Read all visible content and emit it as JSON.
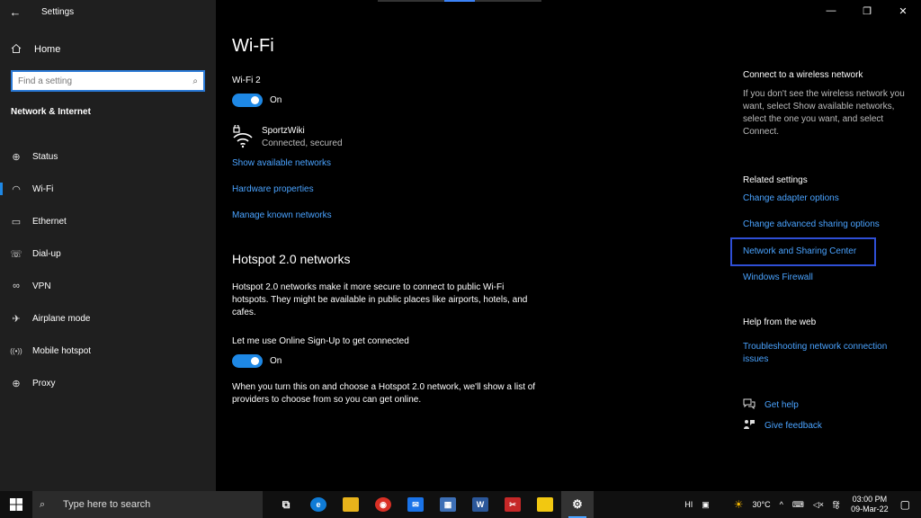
{
  "window": {
    "title": "Settings",
    "back_glyph": "←",
    "controls": {
      "minimize": "—",
      "maximize": "❐",
      "close": "✕"
    }
  },
  "sidebar": {
    "home_label": "Home",
    "search_placeholder": "Find a setting",
    "section_title": "Network & Internet",
    "items": [
      {
        "label": "Status",
        "icon": "status-icon",
        "glyph": "⊕"
      },
      {
        "label": "Wi-Fi",
        "icon": "wifi-icon",
        "glyph": "◠"
      },
      {
        "label": "Ethernet",
        "icon": "ethernet-icon",
        "glyph": "▭"
      },
      {
        "label": "Dial-up",
        "icon": "dialup-icon",
        "glyph": "☏"
      },
      {
        "label": "VPN",
        "icon": "vpn-icon",
        "glyph": "∞"
      },
      {
        "label": "Airplane mode",
        "icon": "airplane-icon",
        "glyph": "✈"
      },
      {
        "label": "Mobile hotspot",
        "icon": "hotspot-icon",
        "glyph": "((•))"
      },
      {
        "label": "Proxy",
        "icon": "globe-icon",
        "glyph": "⊕"
      }
    ]
  },
  "main": {
    "title": "Wi-Fi",
    "adapter_label": "Wi-Fi 2",
    "wifi_toggle": "On",
    "network": {
      "name": "SportzWiki",
      "status": "Connected, secured"
    },
    "links": {
      "show_available": "Show available networks",
      "hardware": "Hardware properties",
      "manage_known": "Manage known networks"
    },
    "hotspot": {
      "heading": "Hotspot 2.0 networks",
      "description": "Hotspot 2.0 networks make it more secure to connect to public Wi-Fi hotspots. They might be available in public places like airports, hotels, and cafes.",
      "signup_label": "Let me use Online Sign-Up to get connected",
      "signup_toggle": "On",
      "signup_description": "When you turn this on and choose a Hotspot 2.0 network, we'll show a list of providers to choose from so you can get online."
    }
  },
  "right": {
    "connect_heading": "Connect to a wireless network",
    "connect_text": "If you don't see the wireless network you want, select Show available networks, select the one you want, and select Connect.",
    "related_heading": "Related settings",
    "related_links": [
      "Change adapter options",
      "Change advanced sharing options",
      "Network and Sharing Center",
      "Windows Firewall"
    ],
    "help_heading": "Help from the web",
    "help_links": [
      "Troubleshooting network connection issues"
    ],
    "get_help": "Get help",
    "give_feedback": "Give feedback"
  },
  "taskbar": {
    "search_text": "Type here to search",
    "apps": [
      {
        "name": "task-view",
        "glyph": "⧉",
        "color": "#101010"
      },
      {
        "name": "edge",
        "glyph": "e",
        "color": "#0f7bd6"
      },
      {
        "name": "file-explorer",
        "glyph": "▬",
        "color": "#e8b31b"
      },
      {
        "name": "chrome",
        "glyph": "◉",
        "color": "#d93025"
      },
      {
        "name": "mail",
        "glyph": "✉",
        "color": "#1a73e8"
      },
      {
        "name": "calculator",
        "glyph": "▦",
        "color": "#3d6fb6"
      },
      {
        "name": "word",
        "glyph": "W",
        "color": "#2b579a"
      },
      {
        "name": "snipping",
        "glyph": "✂",
        "color": "#c62828"
      },
      {
        "name": "sticky-notes",
        "glyph": "▰",
        "color": "#f2c811"
      },
      {
        "name": "settings",
        "glyph": "⚙",
        "color": "#333333"
      }
    ],
    "lang": "HI",
    "temperature": "30°C",
    "input_lang": "हिं",
    "time": "03:00 PM",
    "date": "09-Mar-22"
  },
  "colors": {
    "accent": "#1e88e5",
    "link": "#4aa3ff",
    "sidebar_bg": "#1f1f1f",
    "highlight_border": "#2f4fd6"
  }
}
